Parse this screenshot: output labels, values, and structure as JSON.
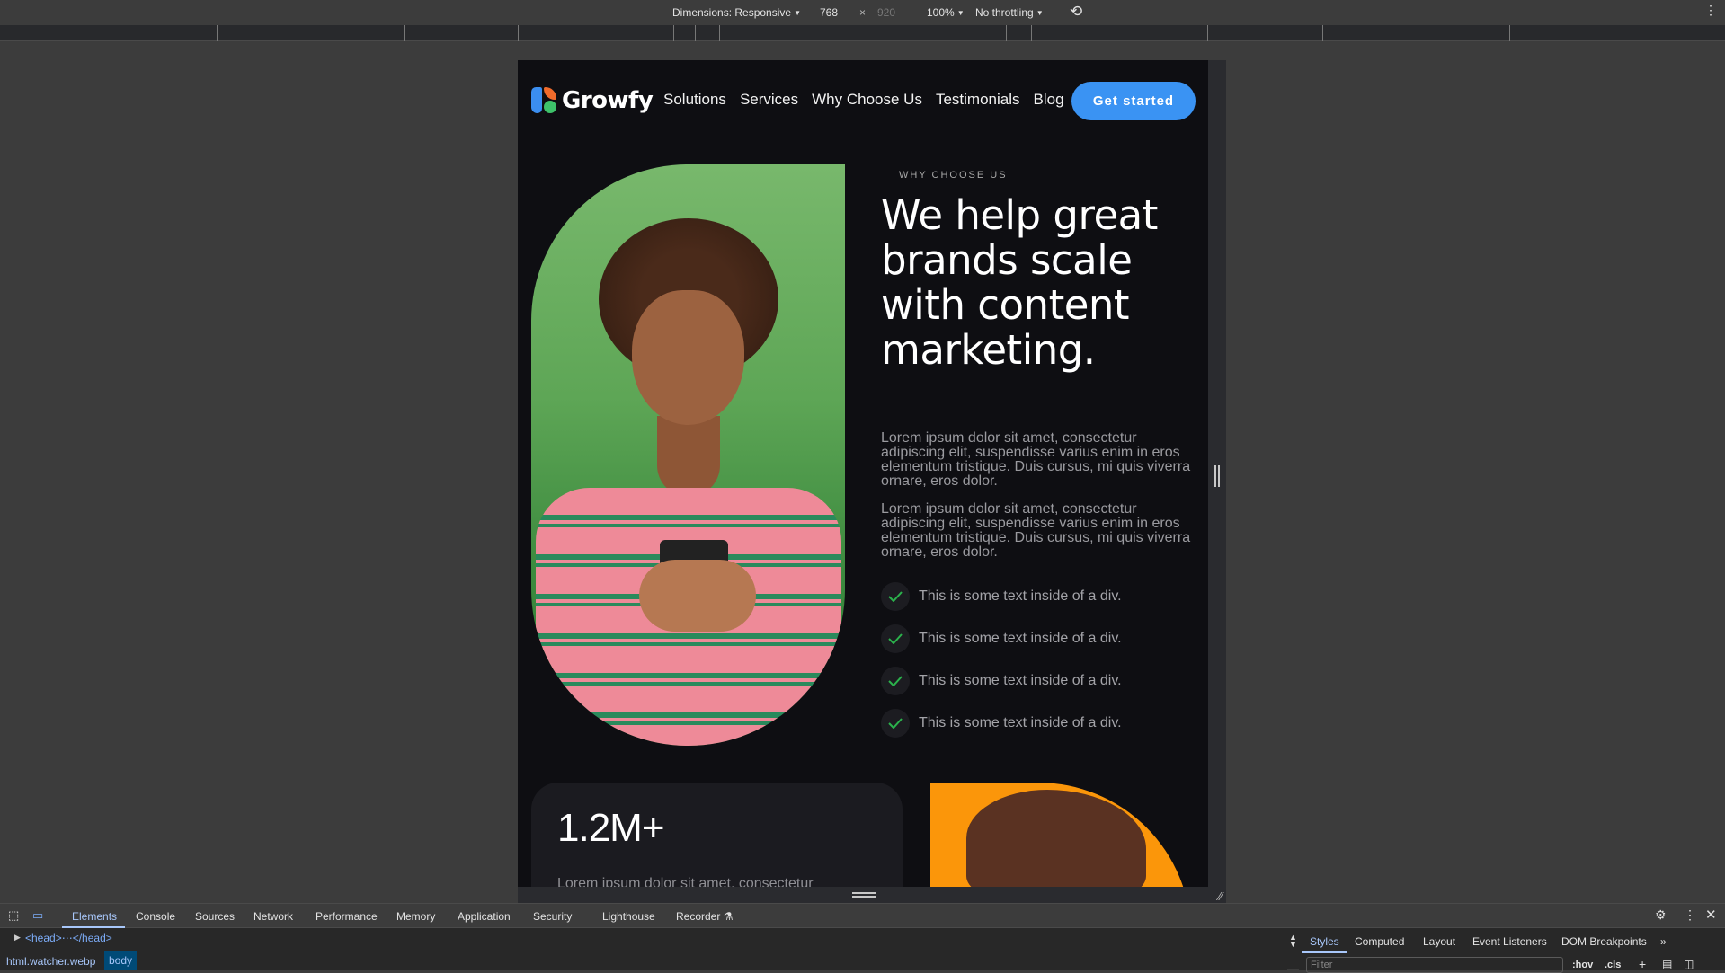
{
  "toolbar": {
    "dimensions_label": "Dimensions: Responsive",
    "width": "768",
    "times": "×",
    "height": "920",
    "zoom": "100%",
    "throttling": "No throttling",
    "rotate_icon": "rotate-icon",
    "more_icon": "kebab-icon"
  },
  "site": {
    "brand": "Growfy",
    "nav": [
      "Solutions",
      "Services",
      "Why Choose Us",
      "Testimonials",
      "Blog"
    ],
    "cta": "Get started",
    "accent": "#3a93f3",
    "eyebrow": "WHY CHOOSE US",
    "headline": "We help great brands scale with content marketing.",
    "paragraphs": [
      "Lorem ipsum dolor sit amet, consectetur adipiscing elit, suspendisse varius enim in eros elementum tristique. Duis cursus, mi quis viverra ornare, eros dolor.",
      "Lorem ipsum dolor sit amet, consectetur adipiscing elit, suspendisse varius enim in eros elementum tristique. Duis cursus, mi quis viverra ornare, eros dolor."
    ],
    "checklist": [
      "This is some text inside of a div.",
      "This is some text inside of a div.",
      "This is some text inside of a div.",
      "This is some text inside of a div."
    ],
    "stat": {
      "value": "1.2M+",
      "text": "Lorem ipsum dolor sit amet, consectetur"
    },
    "hero_image_alt": "woman smiling at phone on green background",
    "second_image_alt": "man on orange background"
  },
  "devtools": {
    "tabs": [
      "Elements",
      "Console",
      "Sources",
      "Network",
      "Performance",
      "Memory",
      "Application",
      "Security",
      "Lighthouse",
      "Recorder"
    ],
    "active_tab": "Elements",
    "dom_line": "<head>⋯</head>",
    "breadcrumbs": [
      "html.watcher.webp",
      "body"
    ],
    "side_tabs": [
      "Styles",
      "Computed",
      "Layout",
      "Event Listeners",
      "DOM Breakpoints",
      "»"
    ],
    "filter_placeholder": "Filter",
    "hov": ":hov",
    "cls": ".cls"
  }
}
